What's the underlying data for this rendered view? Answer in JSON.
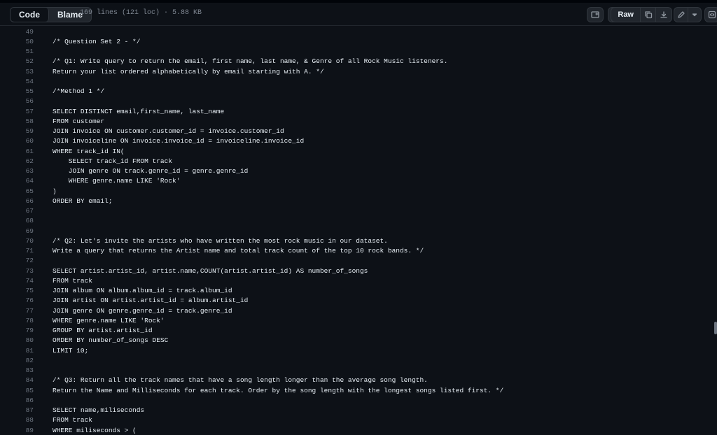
{
  "toolbar": {
    "code_tab": "Code",
    "blame_tab": "Blame",
    "file_info": "169 lines (121 loc) · 5.88 KB",
    "raw_label": "Raw"
  },
  "code": {
    "first_line": 49,
    "lines": [
      "",
      "/* Question Set 2 - */",
      "",
      "/* Q1: Write query to return the email, first name, last name, & Genre of all Rock Music listeners.",
      "Return your list ordered alphabetically by email starting with A. */",
      "",
      "/*Method 1 */",
      "",
      "SELECT DISTINCT email,first_name, last_name",
      "FROM customer",
      "JOIN invoice ON customer.customer_id = invoice.customer_id",
      "JOIN invoiceline ON invoice.invoice_id = invoiceline.invoice_id",
      "WHERE track_id IN(",
      "    SELECT track_id FROM track",
      "    JOIN genre ON track.genre_id = genre.genre_id",
      "    WHERE genre.name LIKE 'Rock'",
      ")",
      "ORDER BY email;",
      "",
      "",
      "",
      "/* Q2: Let's invite the artists who have written the most rock music in our dataset.",
      "Write a query that returns the Artist name and total track count of the top 10 rock bands. */",
      "",
      "SELECT artist.artist_id, artist.name,COUNT(artist.artist_id) AS number_of_songs",
      "FROM track",
      "JOIN album ON album.album_id = track.album_id",
      "JOIN artist ON artist.artist_id = album.artist_id",
      "JOIN genre ON genre.genre_id = track.genre_id",
      "WHERE genre.name LIKE 'Rock'",
      "GROUP BY artist.artist_id",
      "ORDER BY number_of_songs DESC",
      "LIMIT 10;",
      "",
      "",
      "/* Q3: Return all the track names that have a song length longer than the average song length.",
      "Return the Name and Milliseconds for each track. Order by the song length with the longest songs listed first. */",
      "",
      "SELECT name,miliseconds",
      "FROM track",
      "WHERE miliseconds > ("
    ]
  }
}
